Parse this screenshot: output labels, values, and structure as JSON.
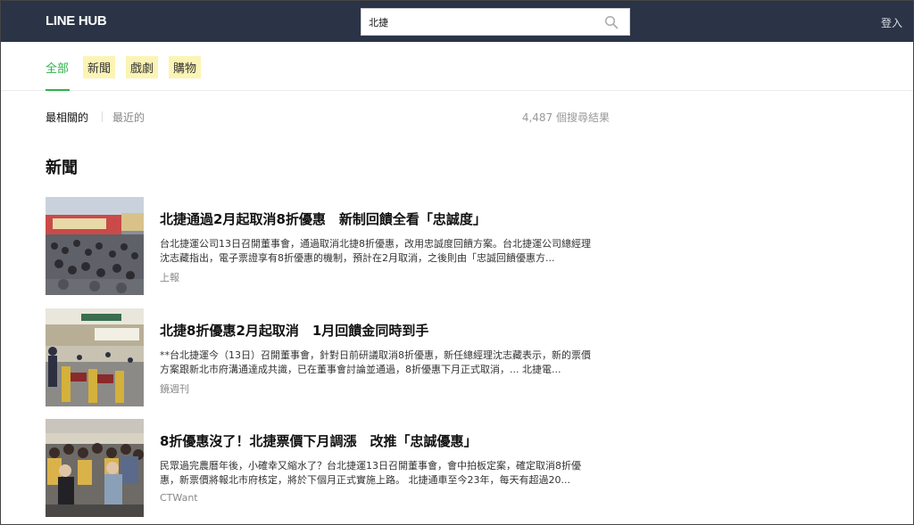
{
  "header": {
    "logo": "LINE HUB",
    "search_value": "北捷",
    "login": "登入"
  },
  "tabs": [
    {
      "label": "全部"
    },
    {
      "label": "新聞"
    },
    {
      "label": "戲劇"
    },
    {
      "label": "購物"
    }
  ],
  "sort": {
    "relevant": "最相關的",
    "recent": "最近的",
    "result_count": "4,487 個搜尋結果"
  },
  "section_title": "新聞",
  "articles": [
    {
      "title": "北捷通過2月起取消8折優惠　新制回饋全看「忠誠度」",
      "snippet": "台北捷運公司13日召開董事會，通過取消北捷8折優惠，改用忠誠度回饋方案。台北捷運公司總經理沈志藏指出，電子票證享有8折優惠的機制，預計在2月取消，之後則由「忠誠回饋優惠方...",
      "source": "上報"
    },
    {
      "title": "北捷8折優惠2月起取消　1月回饋金同時到手",
      "snippet": "**台北捷運今（13日）召開董事會，針對日前研議取消8折優惠，新任總經理沈志藏表示，新的票價方案跟新北市府溝通達成共識，已在董事會討論並通過，8折優惠下月正式取消，... 北捷電...",
      "source": "鏡週刊"
    },
    {
      "title": "8折優惠沒了！北捷票價下月調漲　改推「忠誠優惠」",
      "snippet": "民眾過完農曆年後，小確幸又縮水了？台北捷運13日召開董事會，會中拍板定案，確定取消8折優惠，新票價將報北市府核定，將於下個月正式實施上路。 北捷通車至今23年，每天有超過20...",
      "source": "CTWant"
    }
  ],
  "colors": {
    "header_bg": "#2a3446",
    "accent_green": "#2fb14a",
    "tab_highlight": "#fcf4b4"
  }
}
